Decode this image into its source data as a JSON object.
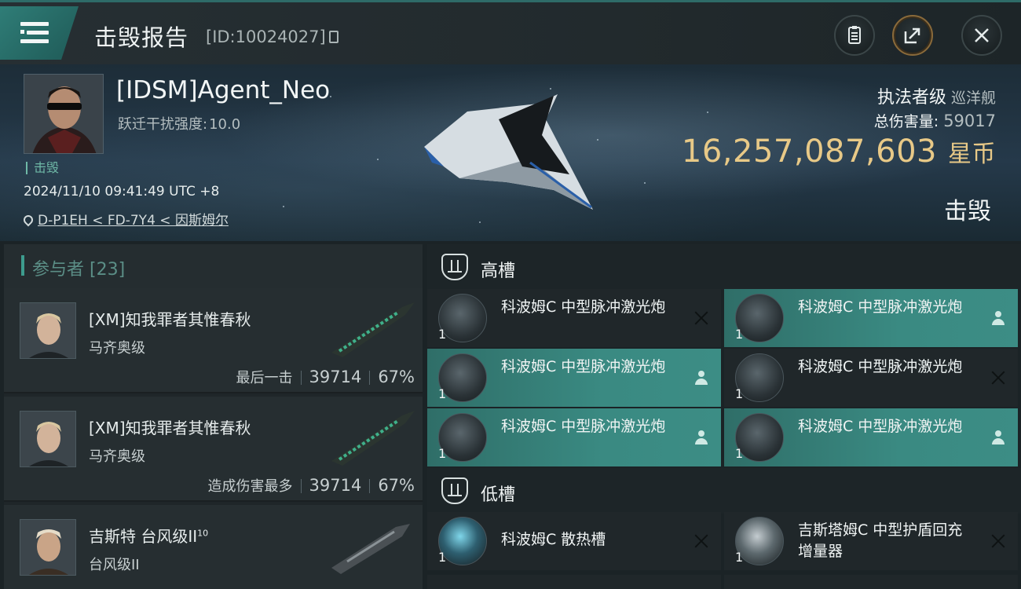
{
  "header": {
    "title": "击毁报告",
    "kill_id": "[ID:10024027]",
    "buttons": [
      "clipboard-icon",
      "share-icon",
      "close-icon"
    ]
  },
  "victim": {
    "name": "[IDSM]Agent_Neo",
    "scram_label": "跃迁干扰强度:",
    "scram_value": "10.0",
    "status_tag": "击毁",
    "datetime": "2024/11/10 09:41:49 UTC +8",
    "location": "D-P1EH < FD-7Y4 < 因斯姆尔",
    "ship_class": "执法者级",
    "ship_type": "巡洋舰",
    "total_damage_label": "总伤害量:",
    "total_damage": "59017",
    "isk_value": "16,257,087,603",
    "isk_unit": "星币",
    "result": "击毁"
  },
  "participants": {
    "label": "参与者 [23]",
    "rows": [
      {
        "name": "[XM]知我罪者其惟春秋",
        "ship": "马齐奥级",
        "role": "最后一击",
        "damage": "39714",
        "percent": "67%"
      },
      {
        "name": "[XM]知我罪者其惟春秋",
        "ship": "马齐奥级",
        "role": "造成伤害最多",
        "damage": "39714",
        "percent": "67%"
      },
      {
        "name": "吉斯特 台风级II",
        "name_sup": "10",
        "ship": "台风级II"
      }
    ]
  },
  "slots": {
    "high_label": "高槽",
    "low_label": "低槽",
    "high": [
      {
        "name": "科波姆C 中型脉冲激光炮",
        "qty": "1",
        "state": "destroyed"
      },
      {
        "name": "科波姆C 中型脉冲激光炮",
        "qty": "1",
        "state": "dropped"
      },
      {
        "name": "科波姆C 中型脉冲激光炮",
        "qty": "1",
        "state": "dropped"
      },
      {
        "name": "科波姆C 中型脉冲激光炮",
        "qty": "1",
        "state": "destroyed"
      },
      {
        "name": "科波姆C 中型脉冲激光炮",
        "qty": "1",
        "state": "dropped"
      },
      {
        "name": "科波姆C 中型脉冲激光炮",
        "qty": "1",
        "state": "dropped"
      }
    ],
    "low": [
      {
        "name": "科波姆C 散热槽",
        "qty": "1",
        "state": "destroyed"
      },
      {
        "name": "吉斯塔姆C 中型护盾回充增量器",
        "qty": "1",
        "state": "destroyed"
      }
    ]
  },
  "colors": {
    "accent": "#3a8a82",
    "isk": "#e8c987",
    "panel": "#20272a"
  }
}
